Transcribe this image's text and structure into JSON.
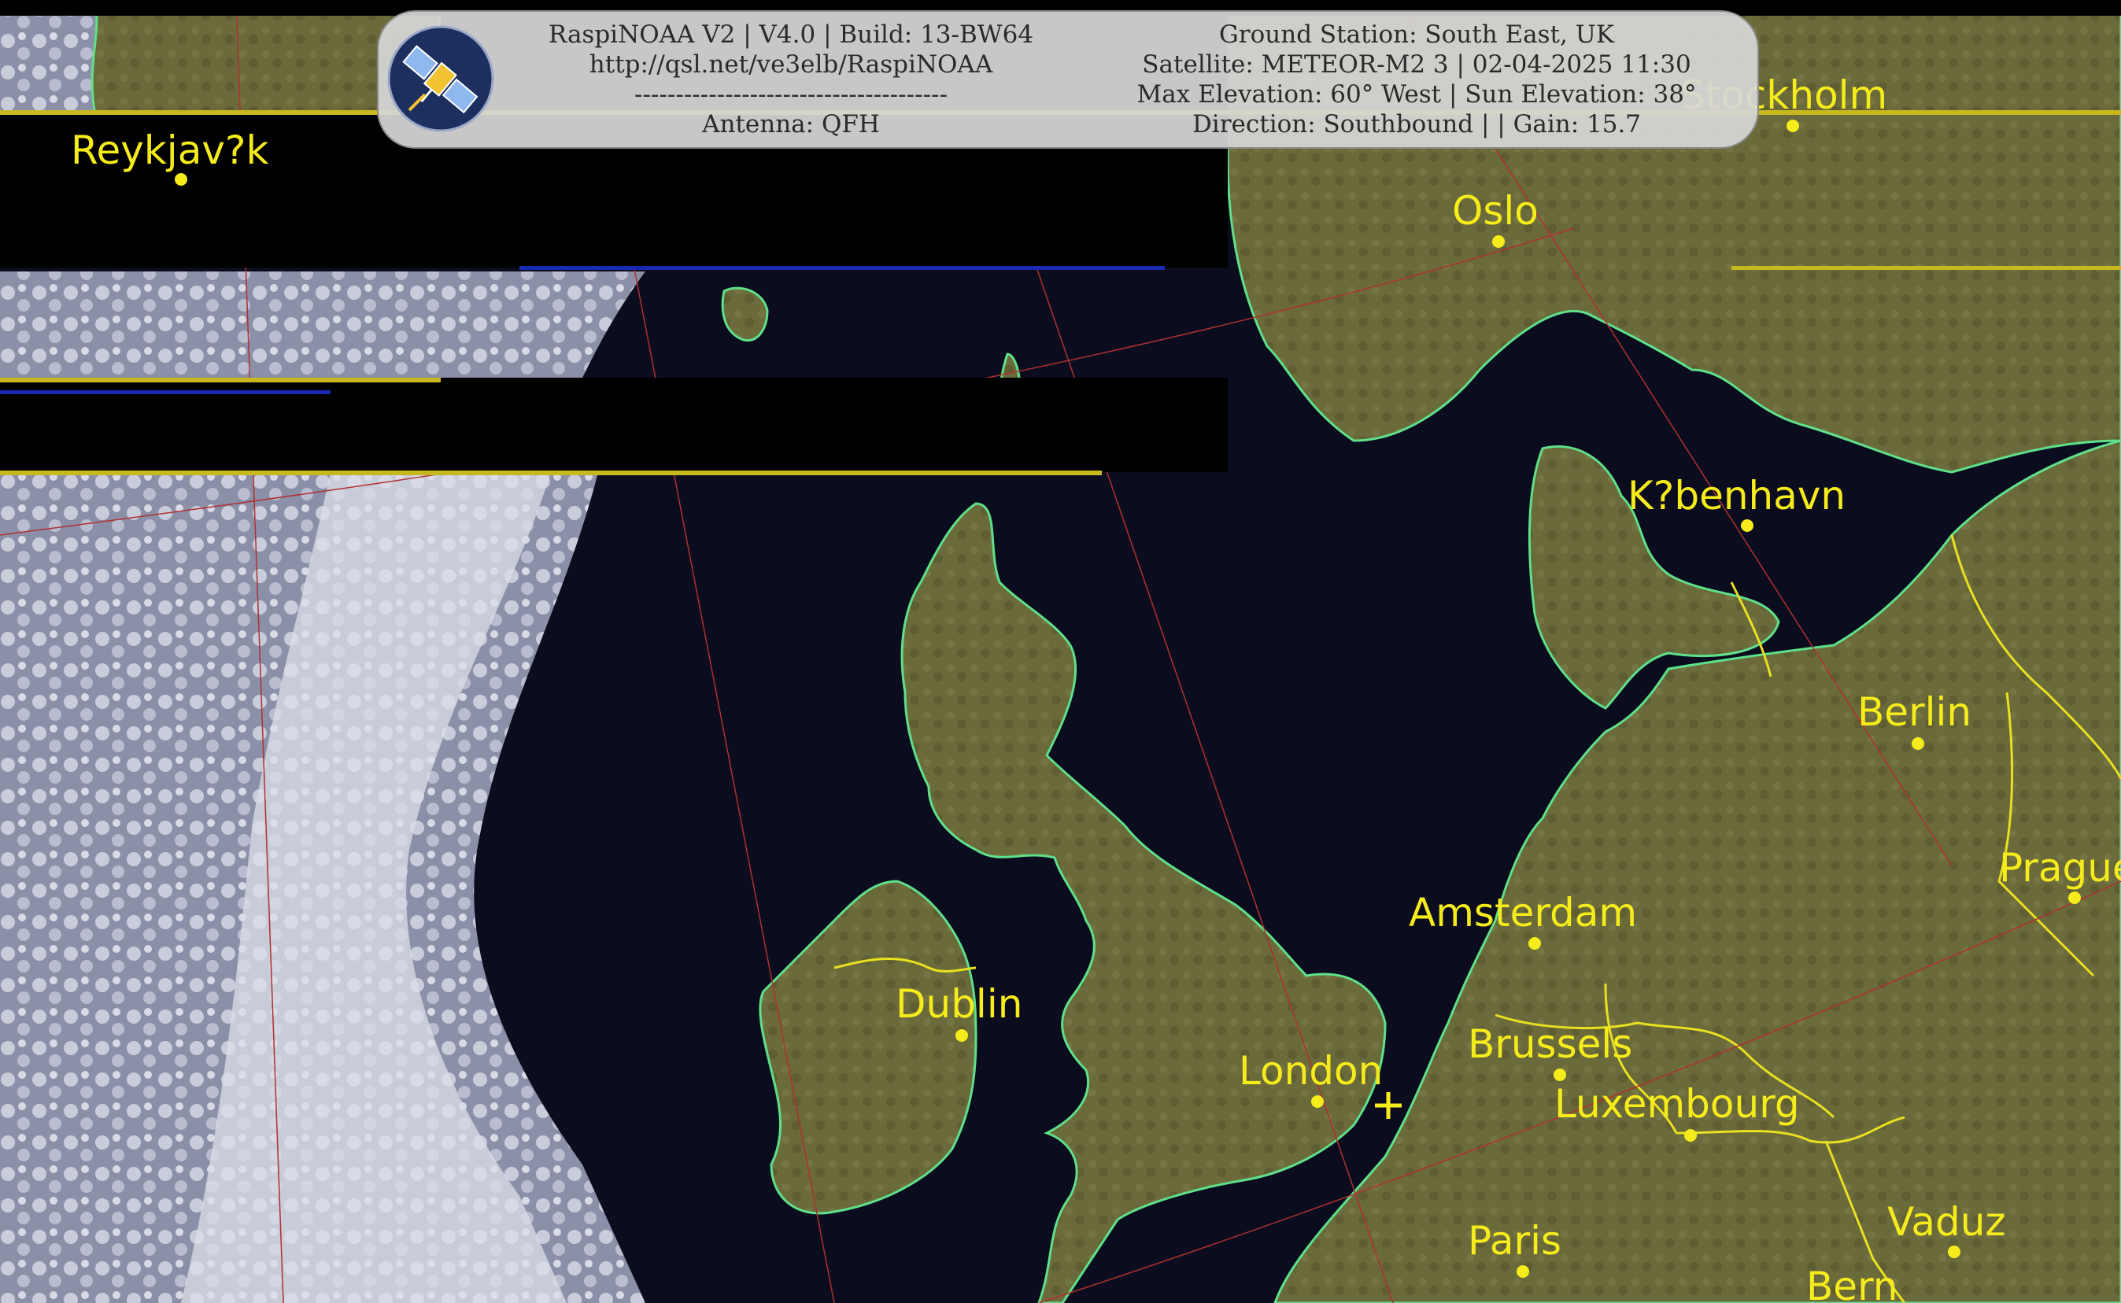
{
  "header": {
    "line1_left": "RaspiNOAA V2 | V4.0 | Build: 13-BW64",
    "line2_left": "http://qsl.net/ve3elb/RaspiNOAA",
    "line3_left": "--------------------------------------",
    "line4_left": "Antenna: QFH",
    "line1_right": "Ground Station: South East, UK",
    "line2_right": "Satellite: METEOR-M2 3 | 02-04-2025 11:30",
    "line3_right": "Max Elevation: 60° West | Sun Elevation: 38°",
    "line4_right": "Direction: Southbound | | Gain: 15.7",
    "logo_icon": "satellite-icon"
  },
  "cities": [
    {
      "name": "Reykjav?k"
    },
    {
      "name": "Stockholm"
    },
    {
      "name": "Oslo"
    },
    {
      "name": "K?benhavn"
    },
    {
      "name": "Berlin"
    },
    {
      "name": "Prague"
    },
    {
      "name": "Amsterdam"
    },
    {
      "name": "Dublin"
    },
    {
      "name": "Brussels"
    },
    {
      "name": "London"
    },
    {
      "name": "Luxembourg"
    },
    {
      "name": "Paris"
    },
    {
      "name": "Vaduz"
    },
    {
      "name": "Bern"
    }
  ],
  "colors": {
    "ocean": "#0b0d1e",
    "land": "#6b6a3a",
    "cloud": "#c9cbd6",
    "coastline": "#5fe08a",
    "border": "#e8e020",
    "label": "#f6ec1c",
    "gridline": "#b03030"
  }
}
